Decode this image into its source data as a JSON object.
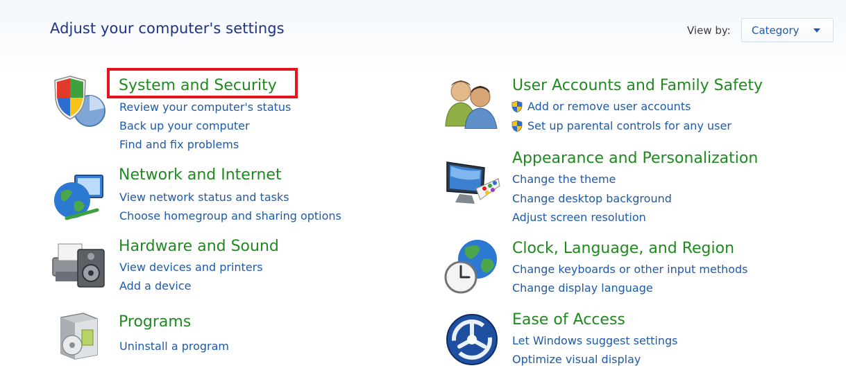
{
  "header": {
    "title": "Adjust your computer's settings",
    "view_by_label": "View by:",
    "view_by_value": "Category"
  },
  "categories": {
    "system_security": {
      "title": "System and Security",
      "links": [
        "Review your computer's status",
        "Back up your computer",
        "Find and fix problems"
      ]
    },
    "network_internet": {
      "title": "Network and Internet",
      "links": [
        "View network status and tasks",
        "Choose homegroup and sharing options"
      ]
    },
    "hardware_sound": {
      "title": "Hardware and Sound",
      "links": [
        "View devices and printers",
        "Add a device"
      ]
    },
    "programs": {
      "title": "Programs",
      "links": [
        "Uninstall a program"
      ]
    },
    "user_accounts": {
      "title": "User Accounts and Family Safety",
      "links": [
        "Add or remove user accounts",
        "Set up parental controls for any user"
      ]
    },
    "appearance": {
      "title": "Appearance and Personalization",
      "links": [
        "Change the theme",
        "Change desktop background",
        "Adjust screen resolution"
      ]
    },
    "clock_region": {
      "title": "Clock, Language, and Region",
      "links": [
        "Change keyboards or other input methods",
        "Change display language"
      ]
    },
    "ease_access": {
      "title": "Ease of Access",
      "links": [
        "Let Windows suggest settings",
        "Optimize visual display"
      ]
    }
  },
  "icons": {
    "system_security": "shield-chart-icon",
    "network_internet": "globe-network-icon",
    "hardware_sound": "printer-speaker-icon",
    "programs": "programs-box-icon",
    "user_accounts": "users-icon",
    "appearance": "monitor-palette-icon",
    "clock_region": "globe-clock-icon",
    "ease_access": "ease-of-access-icon",
    "uac_shield": "uac-shield-icon"
  },
  "colors": {
    "category_title": "#1e8a1e",
    "link": "#1e5aa8",
    "heading": "#1e3287",
    "highlight_box": "#e3141b"
  }
}
